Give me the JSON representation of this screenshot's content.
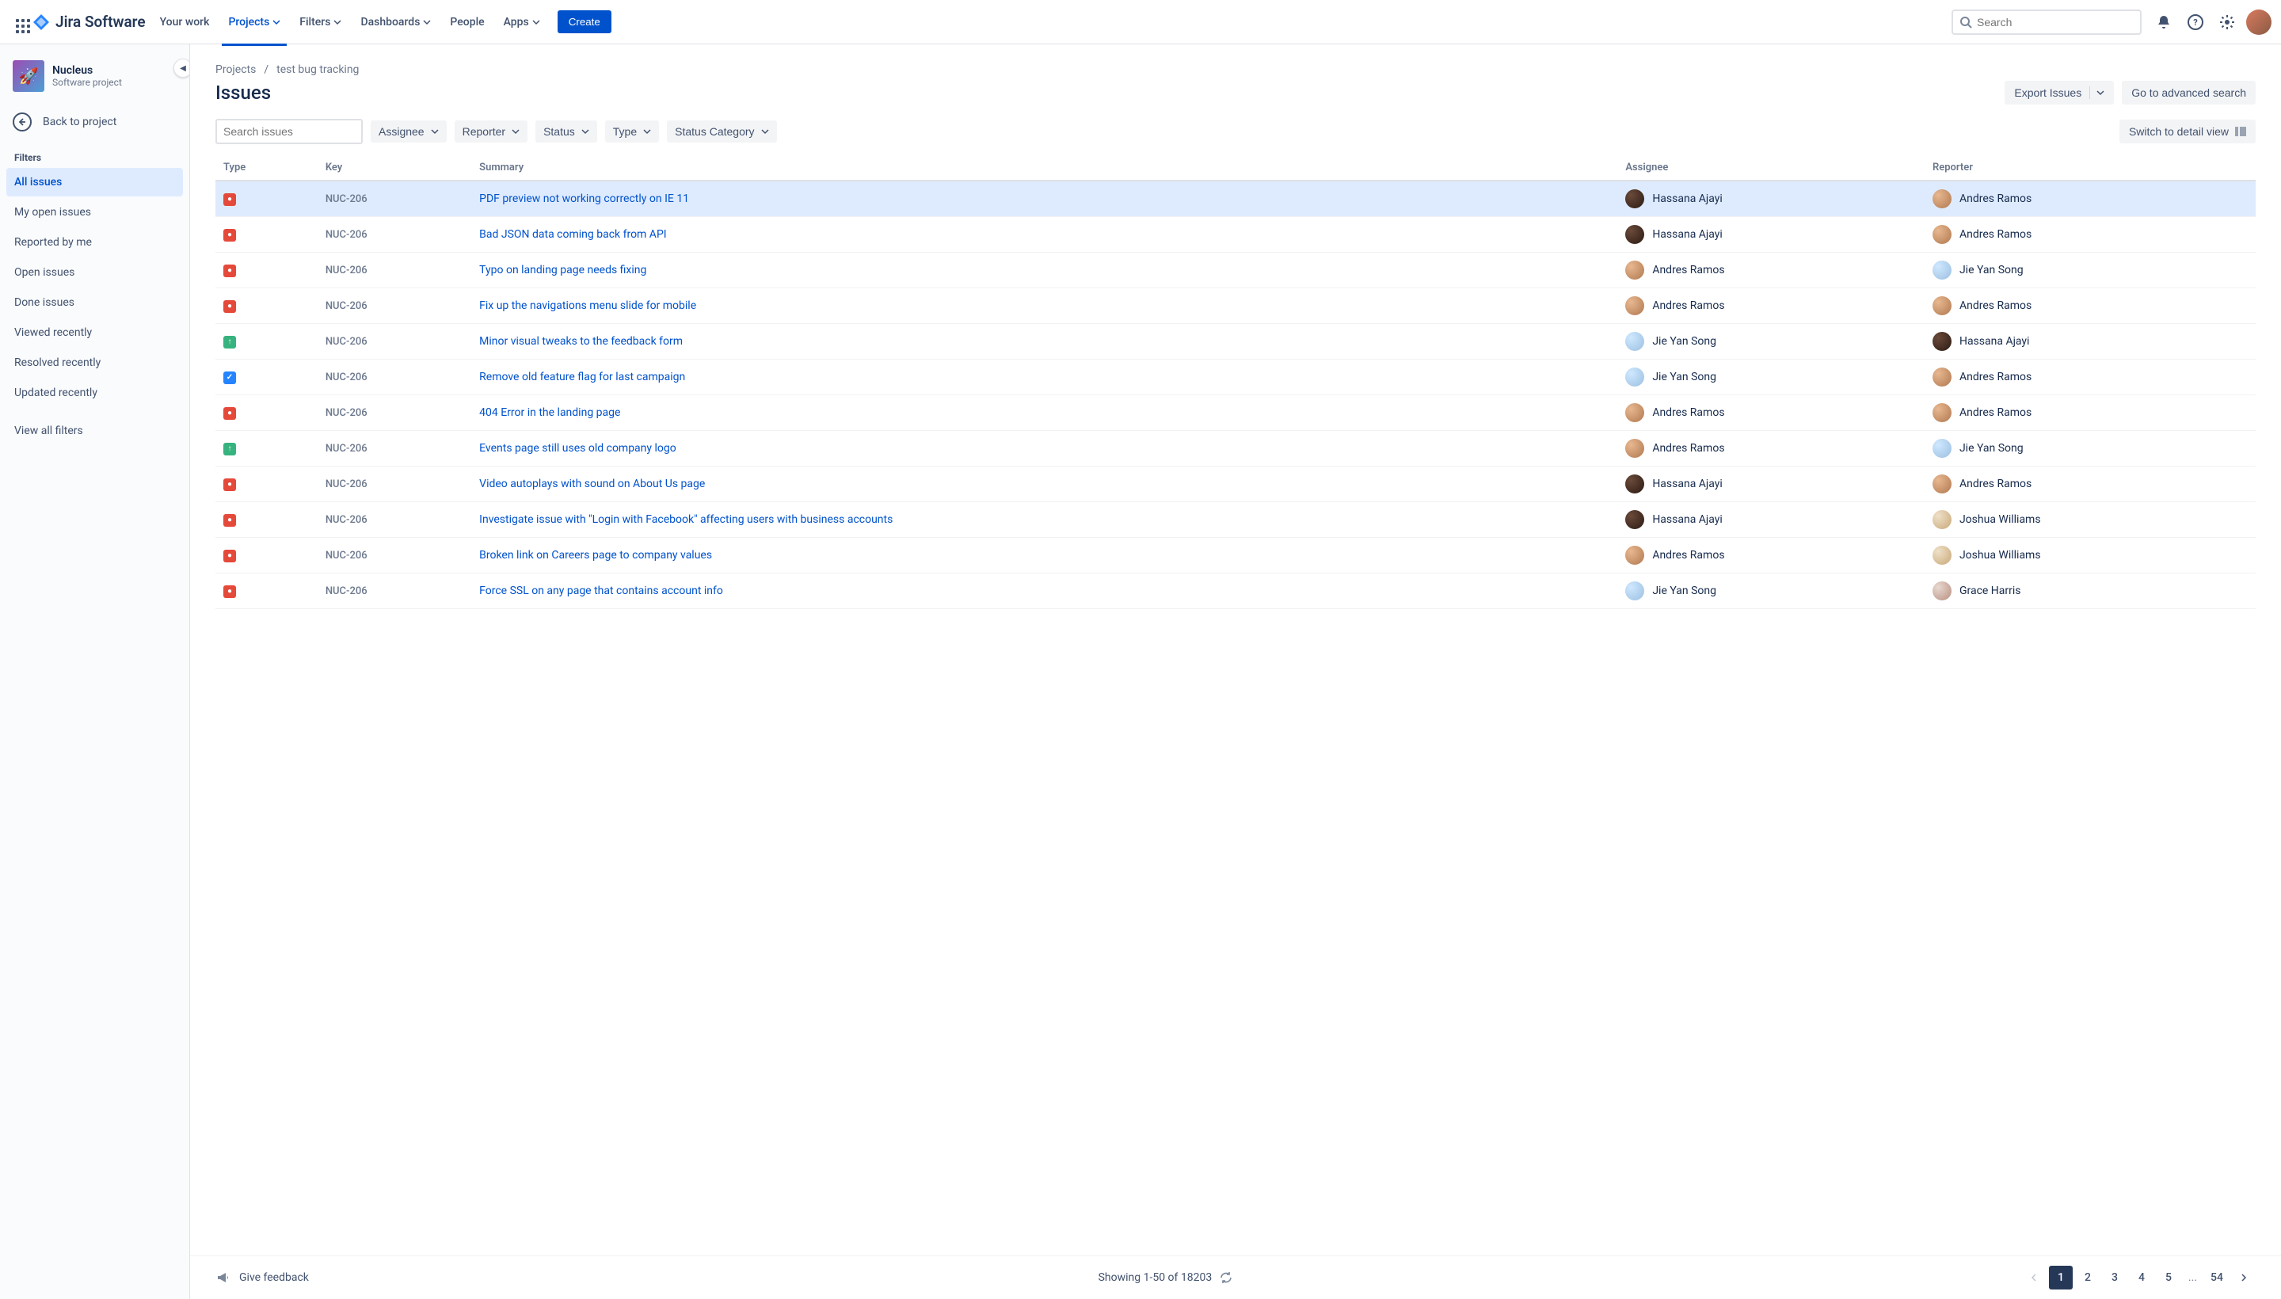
{
  "nav": {
    "logo_text": "Jira Software",
    "your_work": "Your work",
    "projects": "Projects",
    "filters": "Filters",
    "dashboards": "Dashboards",
    "people": "People",
    "apps": "Apps",
    "create": "Create",
    "search_placeholder": "Search"
  },
  "sidebar": {
    "project_name": "Nucleus",
    "project_type": "Software project",
    "back": "Back to project",
    "filters_heading": "Filters",
    "items": [
      {
        "label": "All issues",
        "active": true
      },
      {
        "label": "My open issues"
      },
      {
        "label": "Reported by me"
      },
      {
        "label": "Open issues"
      },
      {
        "label": "Done issues"
      },
      {
        "label": "Viewed recently"
      },
      {
        "label": "Resolved recently"
      },
      {
        "label": "Updated recently"
      }
    ],
    "view_all": "View all filters"
  },
  "breadcrumb": {
    "projects": "Projects",
    "current": "test bug tracking"
  },
  "page_title": "Issues",
  "actions": {
    "export": "Export Issues",
    "advanced": "Go to advanced search",
    "switch_view": "Switch to detail view"
  },
  "filter_bar": {
    "search_placeholder": "Search issues",
    "assignee": "Assignee",
    "reporter": "Reporter",
    "status": "Status",
    "type": "Type",
    "status_category": "Status Category"
  },
  "columns": {
    "type": "Type",
    "key": "Key",
    "summary": "Summary",
    "assignee": "Assignee",
    "reporter": "Reporter"
  },
  "issues": [
    {
      "type": "bug",
      "key": "NUC-206",
      "summary": "PDF preview not working correctly on IE 11",
      "assignee": "Hassana Ajayi",
      "a_av": "hassana",
      "reporter": "Andres Ramos",
      "r_av": "andres",
      "sel": true
    },
    {
      "type": "bug",
      "key": "NUC-206",
      "summary": "Bad JSON data coming back from API",
      "assignee": "Hassana Ajayi",
      "a_av": "hassana",
      "reporter": "Andres Ramos",
      "r_av": "andres"
    },
    {
      "type": "bug",
      "key": "NUC-206",
      "summary": "Typo on landing page needs fixing",
      "assignee": "Andres Ramos",
      "a_av": "andres",
      "reporter": "Jie Yan Song",
      "r_av": "jie"
    },
    {
      "type": "bug",
      "key": "NUC-206",
      "summary": "Fix up the navigations menu slide for mobile",
      "assignee": "Andres Ramos",
      "a_av": "andres",
      "reporter": "Andres Ramos",
      "r_av": "andres"
    },
    {
      "type": "improve",
      "key": "NUC-206",
      "summary": "Minor visual tweaks to the feedback form",
      "assignee": "Jie Yan Song",
      "a_av": "jie",
      "reporter": "Hassana Ajayi",
      "r_av": "hassana"
    },
    {
      "type": "task",
      "key": "NUC-206",
      "summary": "Remove old feature flag for last campaign",
      "assignee": "Jie Yan Song",
      "a_av": "jie",
      "reporter": "Andres Ramos",
      "r_av": "andres"
    },
    {
      "type": "bug",
      "key": "NUC-206",
      "summary": "404 Error in the landing page",
      "assignee": "Andres Ramos",
      "a_av": "andres",
      "reporter": "Andres Ramos",
      "r_av": "andres"
    },
    {
      "type": "improve",
      "key": "NUC-206",
      "summary": "Events page still uses old company logo",
      "assignee": "Andres Ramos",
      "a_av": "andres",
      "reporter": "Jie Yan Song",
      "r_av": "jie"
    },
    {
      "type": "bug",
      "key": "NUC-206",
      "summary": "Video autoplays with sound on About Us page",
      "assignee": "Hassana Ajayi",
      "a_av": "hassana",
      "reporter": "Andres Ramos",
      "r_av": "andres"
    },
    {
      "type": "bug",
      "key": "NUC-206",
      "summary": "Investigate issue with \"Login with Facebook\" affecting users with business accounts",
      "assignee": "Hassana Ajayi",
      "a_av": "hassana",
      "reporter": "Joshua Williams",
      "r_av": "joshua"
    },
    {
      "type": "bug",
      "key": "NUC-206",
      "summary": "Broken link on Careers page to company values",
      "assignee": "Andres Ramos",
      "a_av": "andres",
      "reporter": "Joshua Williams",
      "r_av": "joshua"
    },
    {
      "type": "bug",
      "key": "NUC-206",
      "summary": "Force SSL on any page that contains account info",
      "assignee": "Jie Yan Song",
      "a_av": "jie",
      "reporter": "Grace Harris",
      "r_av": "grace"
    }
  ],
  "footer": {
    "feedback": "Give feedback",
    "showing": "Showing 1-50 of 18203",
    "pages": [
      "1",
      "2",
      "3",
      "4",
      "5"
    ],
    "ellipsis": "...",
    "last": "54"
  }
}
